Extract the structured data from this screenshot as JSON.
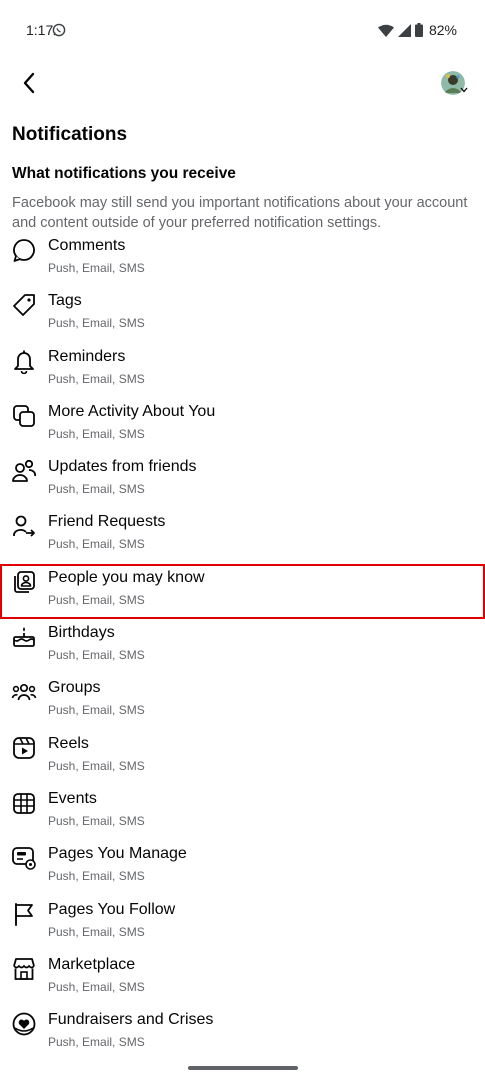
{
  "status_bar": {
    "time": "1:17",
    "battery": "82%",
    "icons": [
      "whatsapp-icon",
      "wifi-icon",
      "signal-icon",
      "battery-icon"
    ]
  },
  "header": {
    "back_icon": "back-arrow-icon",
    "avatar": "profile-avatar"
  },
  "page": {
    "title": "Notifications",
    "section_title": "What notifications you receive",
    "section_description": "Facebook may still send you important notifications about your account and content outside of your preferred notification settings."
  },
  "items": [
    {
      "label": "Comments",
      "sub": "Push, Email, SMS",
      "icon": "comment-icon"
    },
    {
      "label": "Tags",
      "sub": "Push, Email, SMS",
      "icon": "tag-icon"
    },
    {
      "label": "Reminders",
      "sub": "Push, Email, SMS",
      "icon": "bell-icon"
    },
    {
      "label": "More Activity About You",
      "sub": "Push, Email, SMS",
      "icon": "activity-icon"
    },
    {
      "label": "Updates from friends",
      "sub": "Push, Email, SMS",
      "icon": "friends-icon"
    },
    {
      "label": "Friend Requests",
      "sub": "Push, Email, SMS",
      "icon": "friend-request-icon"
    },
    {
      "label": "People you may know",
      "sub": "Push, Email, SMS",
      "icon": "people-you-may-know-icon"
    },
    {
      "label": "Birthdays",
      "sub": "Push, Email, SMS",
      "icon": "birthday-cake-icon"
    },
    {
      "label": "Groups",
      "sub": "Push, Email, SMS",
      "icon": "groups-icon"
    },
    {
      "label": "Reels",
      "sub": "Push, Email, SMS",
      "icon": "reels-icon"
    },
    {
      "label": "Events",
      "sub": "Push, Email, SMS",
      "icon": "calendar-icon"
    },
    {
      "label": "Pages You Manage",
      "sub": "Push, Email, SMS",
      "icon": "pages-manage-icon"
    },
    {
      "label": "Pages You Follow",
      "sub": "Push, Email, SMS",
      "icon": "flag-icon"
    },
    {
      "label": "Marketplace",
      "sub": "Push, Email, SMS",
      "icon": "storefront-icon"
    },
    {
      "label": "Fundraisers and Crises",
      "sub": "Push, Email, SMS",
      "icon": "fundraiser-heart-icon"
    }
  ],
  "colors": {
    "text_primary": "#050505",
    "text_secondary": "#65676b",
    "highlight_border": "#e00000"
  }
}
